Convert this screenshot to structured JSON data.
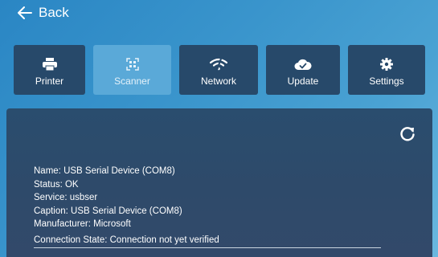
{
  "nav": {
    "back_label": "Back",
    "back_icon": "arrow-left-icon"
  },
  "tabs": [
    {
      "label": "Printer",
      "icon": "printer-icon",
      "active": false
    },
    {
      "label": "Scanner",
      "icon": "qr-scan-icon",
      "active": true
    },
    {
      "label": "Network",
      "icon": "wifi-off-icon",
      "active": false
    },
    {
      "label": "Update",
      "icon": "cloud-check-icon",
      "active": false
    },
    {
      "label": "Settings",
      "icon": "gear-icon",
      "active": false
    }
  ],
  "device": {
    "name": "Name: USB Serial Device (COM8)",
    "status": "Status: OK",
    "service": "Service: usbser",
    "caption": "Caption: USB Serial Device (COM8)",
    "manufacturer": "Manufacturer: Microsoft",
    "connection_state": "Connection State: Connection not yet verified"
  },
  "colors": {
    "background": "#3a95cc",
    "tab": "#27496a",
    "tab_active": "#5aa9d8",
    "panel": "#2e4a6a"
  }
}
